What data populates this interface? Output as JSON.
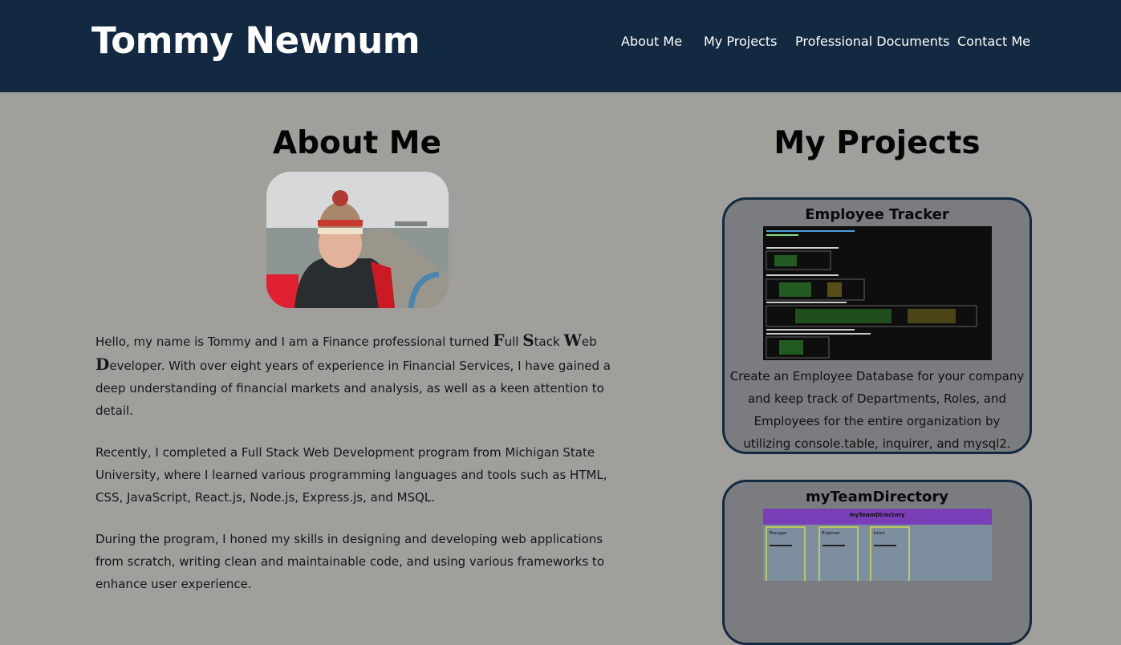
{
  "header": {
    "title": "Tommy Newnum",
    "nav": [
      "About Me",
      "My Projects",
      "Professional Documents",
      "Contact Me"
    ]
  },
  "about": {
    "title": "About Me",
    "p1_part1": "Hello, my name is Tommy and I am a Finance professional turned ",
    "p1_big": [
      "F",
      "S",
      "W",
      "D"
    ],
    "p1_words": [
      "ull ",
      "tack ",
      "eb",
      "eveloper."
    ],
    "p1_part2": " With over eight years of experience in Financial Services, I have gained a deep understanding of financial markets and analysis, as well as a keen attention to detail.",
    "p2": "Recently, I completed a Full Stack Web Development program from Michigan State University, where I learned various programming languages and tools such as HTML, CSS, JavaScript, React.js, Node.js, Express.js, and MSQL.",
    "p3": "During the program, I honed my skills in designing and developing web applications from scratch, writing clean and maintainable code, and using various frameworks to enhance user experience."
  },
  "projects": {
    "title": "My Projects",
    "items": [
      {
        "title": "Employee Tracker",
        "description": "Create an Employee Database for your company and keep track of Departments, Roles, and Employees for the entire organization by utilizing console.table, inquirer, and mysql2."
      },
      {
        "title": "myTeamDirectory",
        "thumb_header": "myTeamDirectory",
        "thumb_cards": [
          "Manager",
          "Engineer",
          "Intern"
        ]
      }
    ]
  },
  "colors": {
    "header_bg": "#132941",
    "page_bg": "#a19f9b",
    "card_bg": "#7b7c7f",
    "card_border": "#132941"
  }
}
